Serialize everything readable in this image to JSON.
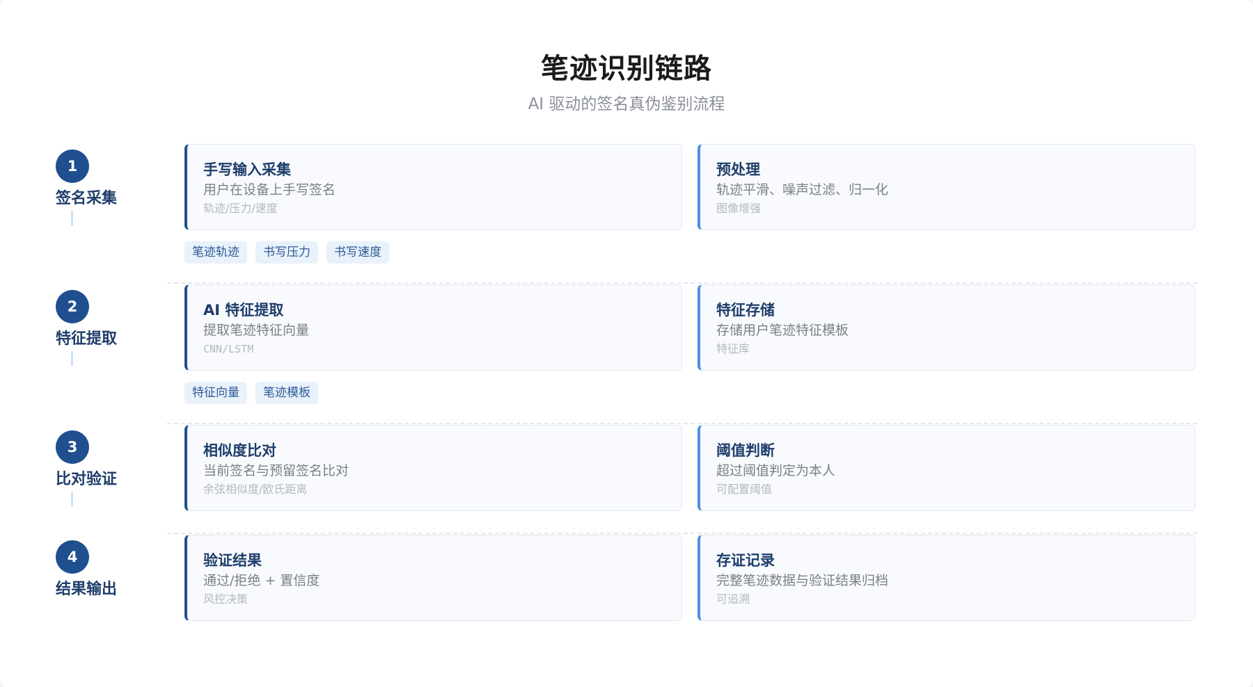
{
  "header": {
    "title": "笔迹识别链路",
    "subtitle": "AI 驱动的签名真伪鉴别流程"
  },
  "stages": [
    {
      "number": "1",
      "label": "签名采集",
      "cards": [
        {
          "title": "手写输入采集",
          "desc": "用户在设备上手写签名",
          "note": "轨迹/压力/速度"
        },
        {
          "title": "预处理",
          "desc": "轨迹平滑、噪声过滤、归一化",
          "note": "图像增强"
        }
      ],
      "tags": [
        "笔迹轨迹",
        "书写压力",
        "书写速度"
      ]
    },
    {
      "number": "2",
      "label": "特征提取",
      "cards": [
        {
          "title": "AI 特征提取",
          "desc": "提取笔迹特征向量",
          "note": "CNN/LSTM"
        },
        {
          "title": "特征存储",
          "desc": "存储用户笔迹特征模板",
          "note": "特征库"
        }
      ],
      "tags": [
        "特征向量",
        "笔迹模板"
      ]
    },
    {
      "number": "3",
      "label": "比对验证",
      "cards": [
        {
          "title": "相似度比对",
          "desc": "当前签名与预留签名比对",
          "note": "余弦相似度/欧氏距离"
        },
        {
          "title": "阈值判断",
          "desc": "超过阈值判定为本人",
          "note": "可配置阈值"
        }
      ],
      "tags": []
    },
    {
      "number": "4",
      "label": "结果输出",
      "cards": [
        {
          "title": "验证结果",
          "desc": "通过/拒绝 + 置信度",
          "note": "风控决策"
        },
        {
          "title": "存证记录",
          "desc": "完整笔迹数据与验证结果归档",
          "note": "可追溯"
        }
      ],
      "tags": []
    }
  ],
  "colors": {
    "primary": "#1f4f8f",
    "accent": "#4a90e2",
    "tag_bg": "#e9f1fb"
  }
}
